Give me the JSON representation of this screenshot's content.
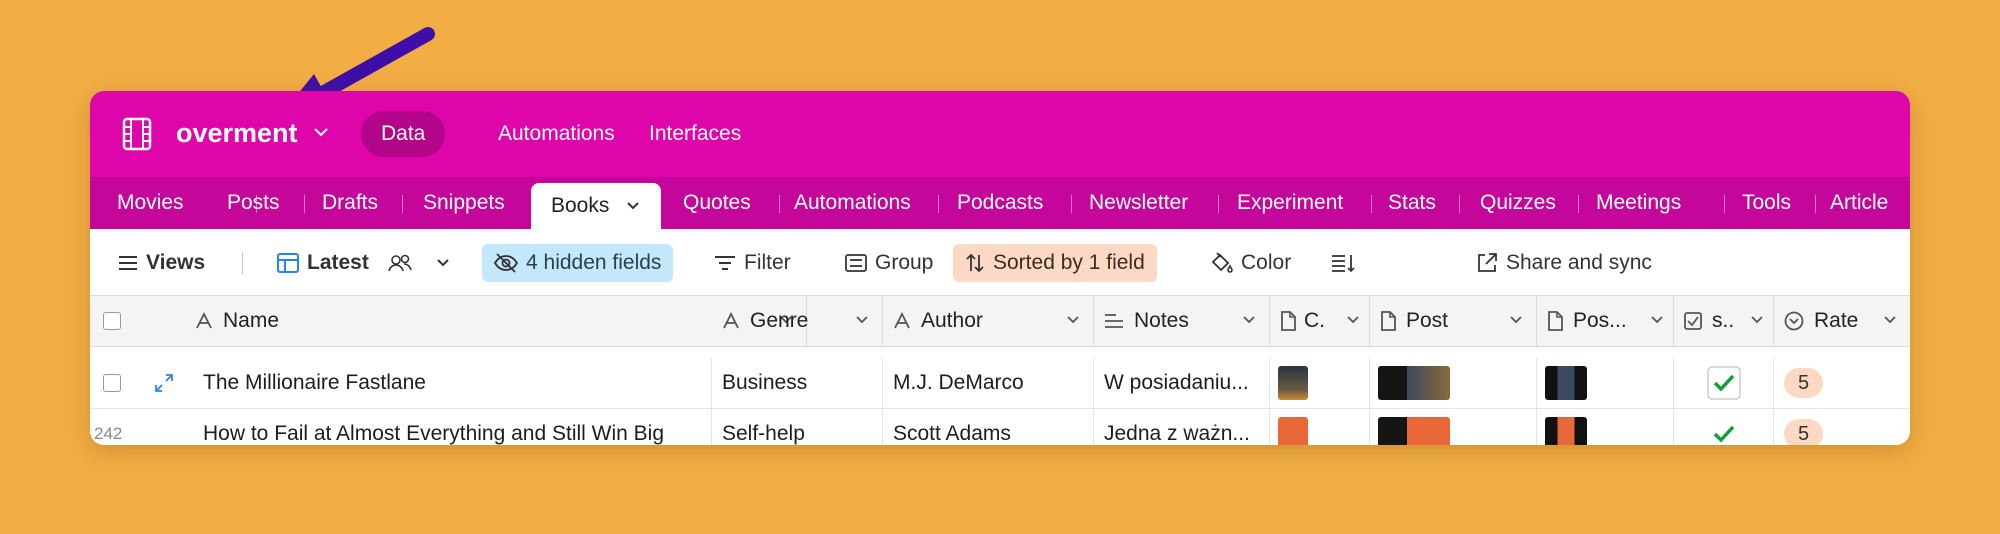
{
  "base": {
    "name": "overment"
  },
  "nav": {
    "data": "Data",
    "automations": "Automations",
    "interfaces": "Interfaces"
  },
  "tabs": [
    "Movies",
    "Posts",
    "Drafts",
    "Snippets",
    "Books",
    "Quotes",
    "Automations",
    "Podcasts",
    "Newsletter",
    "Experiment",
    "Stats",
    "Quizzes",
    "Meetings",
    "Tools",
    "Article"
  ],
  "active_tab": "Books",
  "toolbar": {
    "views": "Views",
    "view_name": "Latest",
    "hidden_fields": "4 hidden fields",
    "filter": "Filter",
    "group": "Group",
    "sorted": "Sorted by 1 field",
    "color": "Color",
    "share": "Share and sync"
  },
  "columns": [
    "Name",
    "Genre",
    "Author",
    "Notes",
    "C.",
    "Post",
    "Pos...",
    "s..",
    "Rate"
  ],
  "rows": [
    {
      "number": "",
      "name": "The Millionaire Fastlane",
      "genre": "Business",
      "author": "M.J. DeMarco",
      "notes": "W posiadaniu...",
      "checked": true,
      "rate": "5"
    },
    {
      "number": "242",
      "name": "How to Fail at Almost Everything and Still Win Big",
      "genre": "Self-help",
      "author": "Scott Adams",
      "notes": "Jedna z ważn...",
      "checked": true,
      "rate": "5"
    }
  ],
  "colors": {
    "background": "#F2AE45",
    "topbar": "#DE05AA",
    "tabbar": "#C4069A",
    "arrow": "#3D0FA8"
  }
}
